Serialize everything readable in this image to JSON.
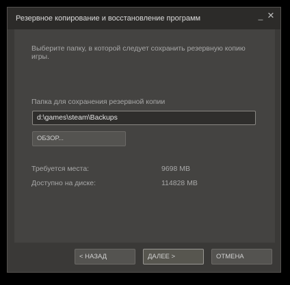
{
  "window": {
    "title": "Резервное копирование и восстановление программ",
    "minimize_glyph": "_",
    "close_glyph": "✕"
  },
  "content": {
    "intro_text": "Выберите папку, в которой следует сохранить резервную копию игры.",
    "folder_label": "Папка для сохранения резервной копии",
    "folder_path": "d:\\games\\steam\\Backups",
    "browse_label": "ОБЗОР...",
    "required_label": "Требуется места:",
    "required_value": "9698 MB",
    "available_label": "Доступно на диске:",
    "available_value": "114828 MB"
  },
  "buttons": {
    "back_label": "< НАЗАД",
    "next_label": "ДАЛЕЕ >",
    "cancel_label": "ОТМЕНА"
  },
  "icons": {
    "minimize": "minimize-icon",
    "close": "close-icon"
  },
  "colors": {
    "window_bg": "#3a3937",
    "content_bg": "#444341",
    "text": "#a8a8a8"
  }
}
